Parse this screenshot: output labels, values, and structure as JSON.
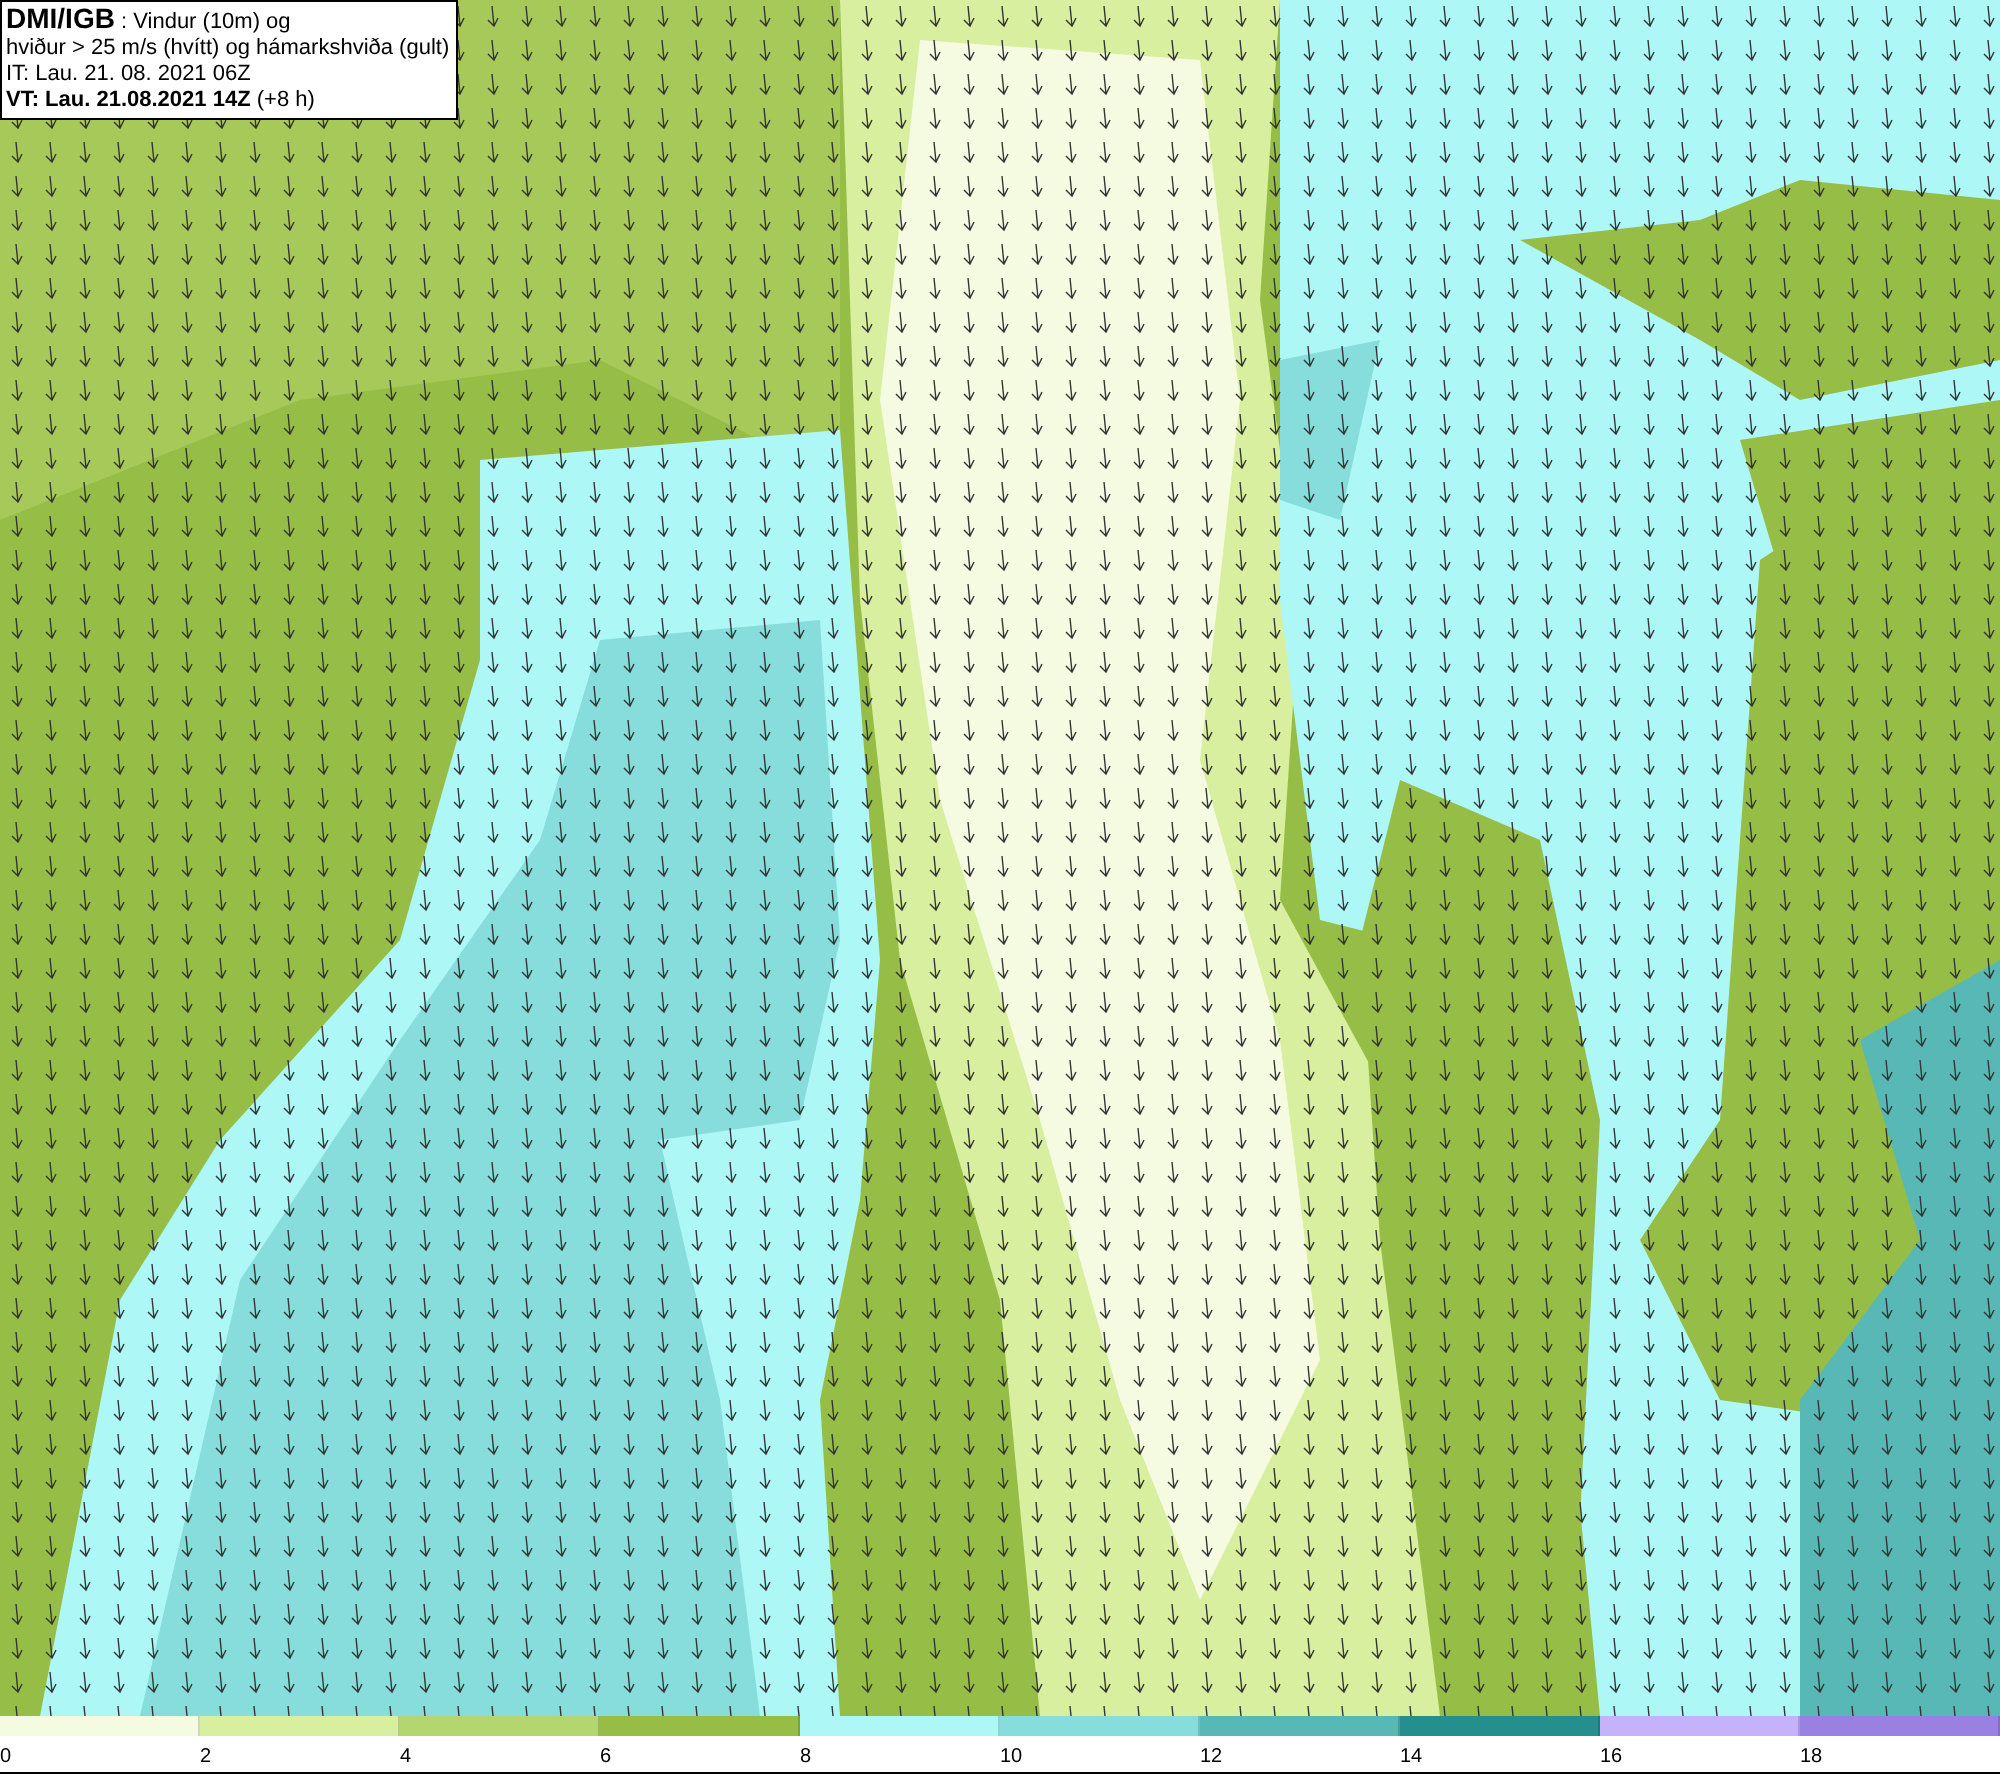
{
  "title_box": {
    "lines": [
      "**DMI/IGB** : Vindur (10m) og",
      "hviður > 25 m/s (hvítt) og hámarkshviða (gult)",
      "IT: Lau. 21. 08. 2021 06Z",
      "**VT: Lau. 21.08.2021 14Z** (+8 h)"
    ]
  },
  "legend": {
    "bins": [
      {
        "label": "0",
        "color": "#f4fbe0"
      },
      {
        "label": "2",
        "color": "#d7ef9e"
      },
      {
        "label": "4",
        "color": "#b3d670"
      },
      {
        "label": "6",
        "color": "#96be46"
      },
      {
        "label": "8",
        "color": "#aef7f7"
      },
      {
        "label": "10",
        "color": "#86dddb"
      },
      {
        "label": "12",
        "color": "#57b8b5"
      },
      {
        "label": "14",
        "color": "#248f8c"
      },
      {
        "label": "16",
        "color": "#c4b3fb"
      },
      {
        "label": "18",
        "color": "#9a80e0"
      }
    ]
  }
}
